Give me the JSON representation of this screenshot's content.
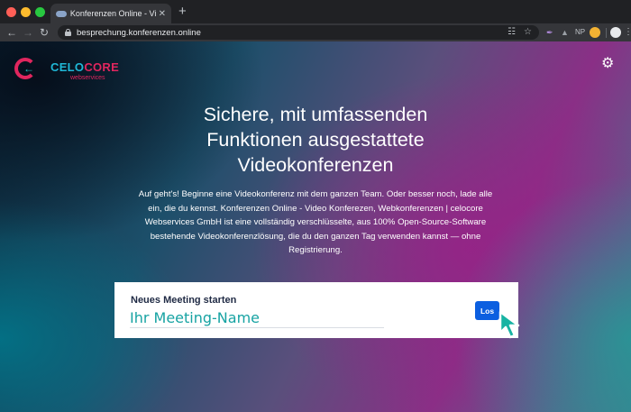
{
  "browser": {
    "tab_title": "Konferenzen Online - Video Konferenzen",
    "tab_close": "✕",
    "new_tab": "+",
    "url": "besprechung.konferenzen.online",
    "extension_label": "NP",
    "icons": [
      "back-icon",
      "forward-icon",
      "reload-icon",
      "lock-icon",
      "translate-icon",
      "star-icon",
      "profile-icon",
      "menu-icon"
    ]
  },
  "logo": {
    "name_part1": "CELO",
    "name_part2": "CORE",
    "subtitle": "webservices",
    "colors": {
      "primary": "#1fb7d6",
      "accent": "#e0265e"
    }
  },
  "hero": {
    "headline_line1": "Sichere, mit umfassenden",
    "headline_line2": "Funktionen ausgestattete",
    "headline_line3": "Videokonferenzen",
    "intro": "Auf geht's! Beginne eine Videokonferenz mit dem ganzen Team. Oder besser noch, lade alle ein, die du kennst. Konferenzen Online - Video Konferezen, Webkonferenzen | celocore Webservices GmbH ist eine vollständig verschlüsselte, aus 100% Open-Source-Software bestehende Videokonferenzlösung, die du den ganzen Tag verwenden kannst — ohne Registrierung."
  },
  "meeting": {
    "title": "Neues Meeting starten",
    "placeholder": "Ihr Meeting-Name",
    "value": "",
    "button_label": "Los",
    "button_color": "#0c5fe0"
  }
}
